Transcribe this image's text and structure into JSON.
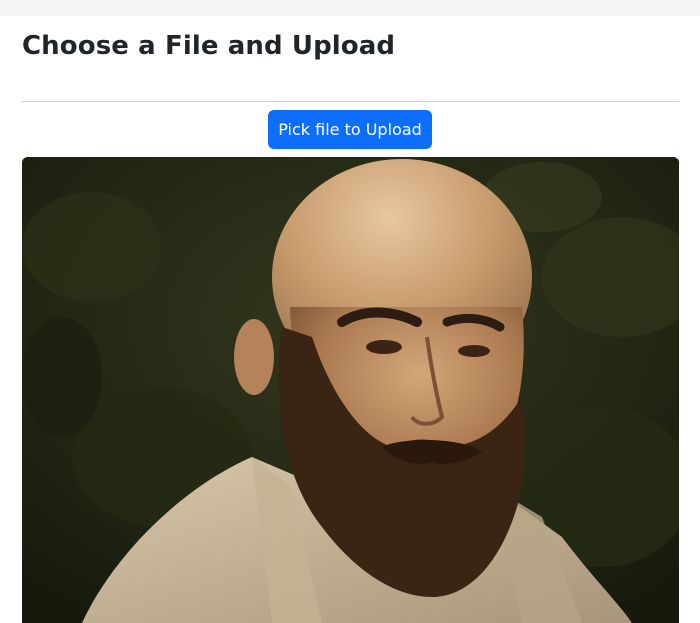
{
  "page": {
    "title": "Choose a File and Upload"
  },
  "upload": {
    "button_label": "Pick file to Upload"
  },
  "colors": {
    "topbar": "#f3f4f6",
    "primary": "#0d6efd",
    "heading": "#212529",
    "divider": "#cfd3d7",
    "photo_background": "#1f2413"
  }
}
